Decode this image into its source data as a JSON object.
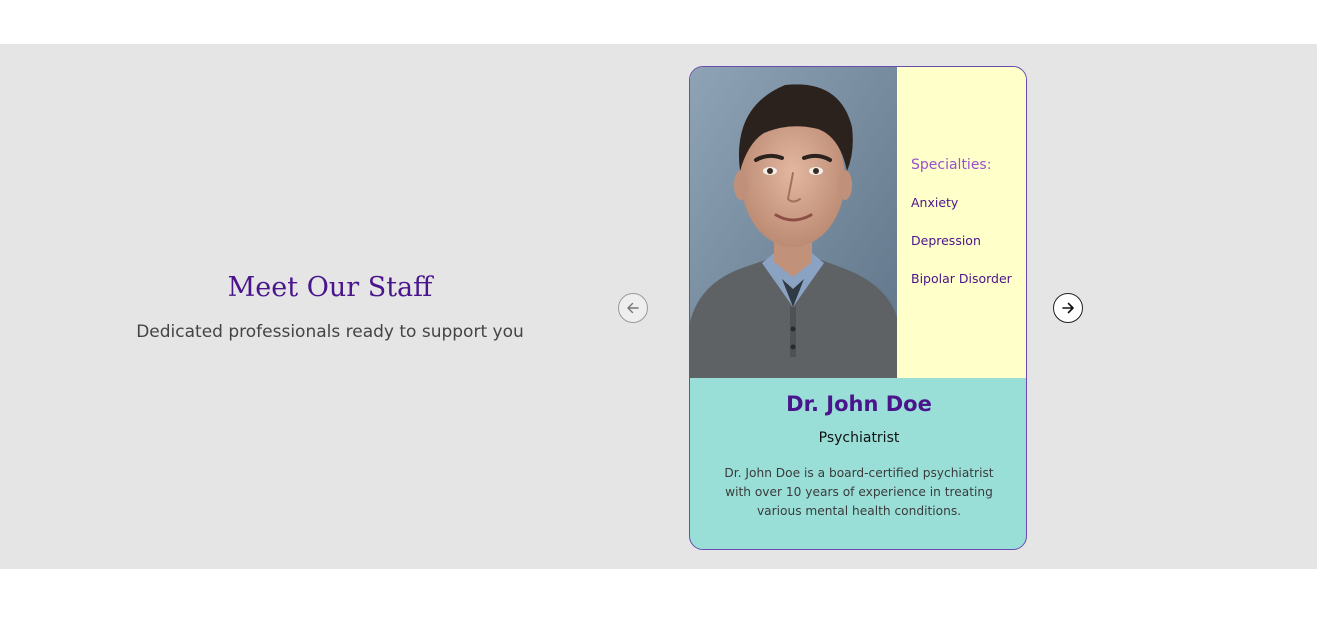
{
  "section": {
    "title": "Meet Our Staff",
    "subtitle": "Dedicated professionals ready to support you"
  },
  "carousel": {
    "prev_icon": "arrow-left-icon",
    "next_icon": "arrow-right-icon"
  },
  "staff_card": {
    "name": "Dr. John Doe",
    "role": "Psychiatrist",
    "bio": "Dr. John Doe is a board-certified psychiatrist with over 10 years of experience in treating various mental health conditions.",
    "specialties_heading": "Specialties:",
    "specialties": [
      "Anxiety",
      "Depression",
      "Bipolar Disorder"
    ]
  },
  "colors": {
    "band_background": "#e5e5e5",
    "accent_purple": "#4a148c",
    "specialties_panel": "#ffffc9",
    "info_panel": "#99dfd8"
  }
}
